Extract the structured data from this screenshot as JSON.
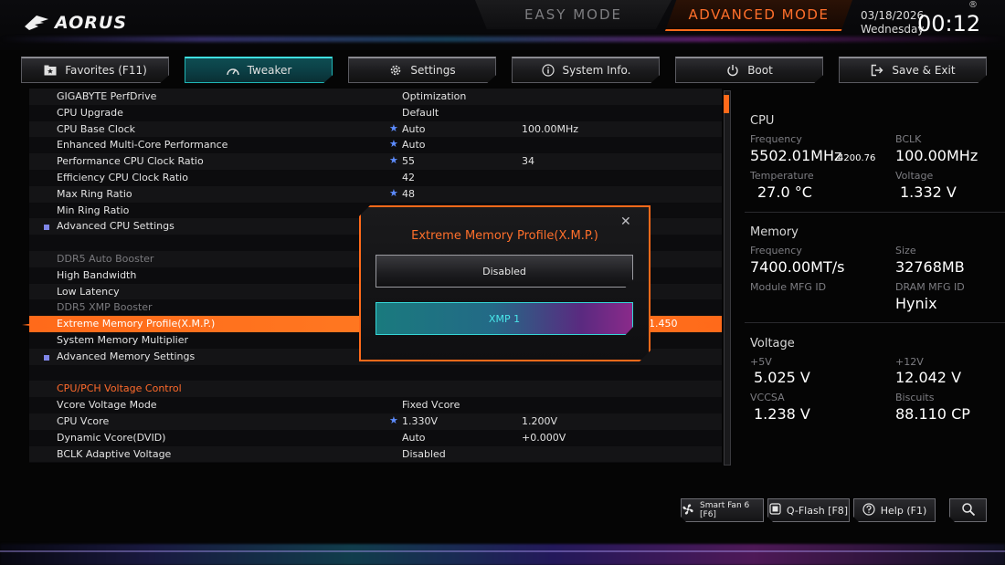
{
  "header": {
    "logo": "AORUS",
    "easy_mode": "EASY MODE",
    "advanced_mode": "ADVANCED MODE",
    "date": "03/18/2026",
    "weekday": "Wednesday",
    "time": "00:12",
    "registered": "®"
  },
  "tabs": [
    {
      "label": "Favorites (F11)",
      "icon": "star-folder-icon"
    },
    {
      "label": "Tweaker",
      "icon": "speedometer-icon",
      "active": true
    },
    {
      "label": "Settings",
      "icon": "gear-icon"
    },
    {
      "label": "System Info.",
      "icon": "info-icon"
    },
    {
      "label": "Boot",
      "icon": "power-icon"
    },
    {
      "label": "Save & Exit",
      "icon": "exit-icon"
    }
  ],
  "settings": [
    {
      "label": "GIGABYTE PerfDrive",
      "v1": "Optimization",
      "v2": ""
    },
    {
      "label": "CPU Upgrade",
      "v1": "Default",
      "v2": ""
    },
    {
      "label": "CPU Base Clock",
      "v1": "Auto",
      "v2": "100.00MHz",
      "star": true
    },
    {
      "label": "Enhanced Multi-Core Performance",
      "v1": "Auto",
      "v2": "",
      "star": true
    },
    {
      "label": "Performance CPU Clock Ratio",
      "v1": "55",
      "v2": "34",
      "star": true
    },
    {
      "label": "Efficiency CPU Clock Ratio",
      "v1": "42",
      "v2": ""
    },
    {
      "label": "Max Ring Ratio",
      "v1": "48",
      "v2": "",
      "star": true
    },
    {
      "label": "Min Ring Ratio",
      "v1": "",
      "v2": ""
    },
    {
      "label": "Advanced CPU Settings",
      "v1": "",
      "v2": "",
      "submenu": true
    },
    {
      "label": "",
      "v1": "",
      "v2": ""
    },
    {
      "label": "DDR5 Auto Booster",
      "v1": "",
      "v2": "",
      "dim": true
    },
    {
      "label": "High Bandwidth",
      "v1": "",
      "v2": ""
    },
    {
      "label": "Low Latency",
      "v1": "",
      "v2": ""
    },
    {
      "label": "DDR5 XMP Booster",
      "v1": "",
      "v2": "",
      "dim": true
    },
    {
      "label": "Extreme Memory Profile(X.M.P.)",
      "v1": "",
      "v2": "1.450",
      "highlight": true
    },
    {
      "label": "System Memory Multiplier",
      "v1": "",
      "v2": ""
    },
    {
      "label": "Advanced Memory Settings",
      "v1": "",
      "v2": "",
      "submenu": true
    },
    {
      "label": "",
      "v1": "",
      "v2": ""
    },
    {
      "label": "CPU/PCH Voltage Control",
      "v1": "",
      "v2": "",
      "section": true
    },
    {
      "label": "Vcore Voltage Mode",
      "v1": "Fixed Vcore",
      "v2": ""
    },
    {
      "label": "CPU Vcore",
      "v1": "1.330V",
      "v2": "1.200V",
      "star": true
    },
    {
      "label": "Dynamic Vcore(DVID)",
      "v1": "Auto",
      "v2": "+0.000V"
    },
    {
      "label": "BCLK Adaptive Voltage",
      "v1": "Disabled",
      "v2": ""
    }
  ],
  "modal": {
    "title": "Extreme Memory Profile(X.M.P.)",
    "options": [
      "Disabled",
      "XMP 1"
    ],
    "selected": "XMP 1"
  },
  "info": {
    "cpu": {
      "heading": "CPU",
      "freq_label": "Frequency",
      "freq": "5502.01MHz",
      "freq_sub": "4200.76",
      "bclk_label": "BCLK",
      "bclk": "100.00MHz",
      "temp_label": "Temperature",
      "temp": "27.0 °C",
      "volt_label": "Voltage",
      "volt": "1.332 V"
    },
    "memory": {
      "heading": "Memory",
      "freq_label": "Frequency",
      "freq": "7400.00MT/s",
      "size_label": "Size",
      "size": "32768MB",
      "mfg_label": "Module MFG ID",
      "mfg": "",
      "dram_label": "DRAM MFG ID",
      "dram": "Hynix"
    },
    "voltage": {
      "heading": "Voltage",
      "v5_label": "+5V",
      "v5": "5.025 V",
      "v12_label": "+12V",
      "v12": "12.042 V",
      "vccsa_label": "VCCSA",
      "vccsa": "1.238 V",
      "biscuits_label": "Biscuits",
      "biscuits": "88.110 CP"
    }
  },
  "bottom": {
    "smart_fan": "Smart Fan 6 [F6]",
    "qflash": "Q-Flash [F8]",
    "help": "Help (F1)"
  },
  "colors": {
    "accent": "#ff6a1a",
    "teal": "#35d6d6",
    "star": "#5d8cff"
  }
}
